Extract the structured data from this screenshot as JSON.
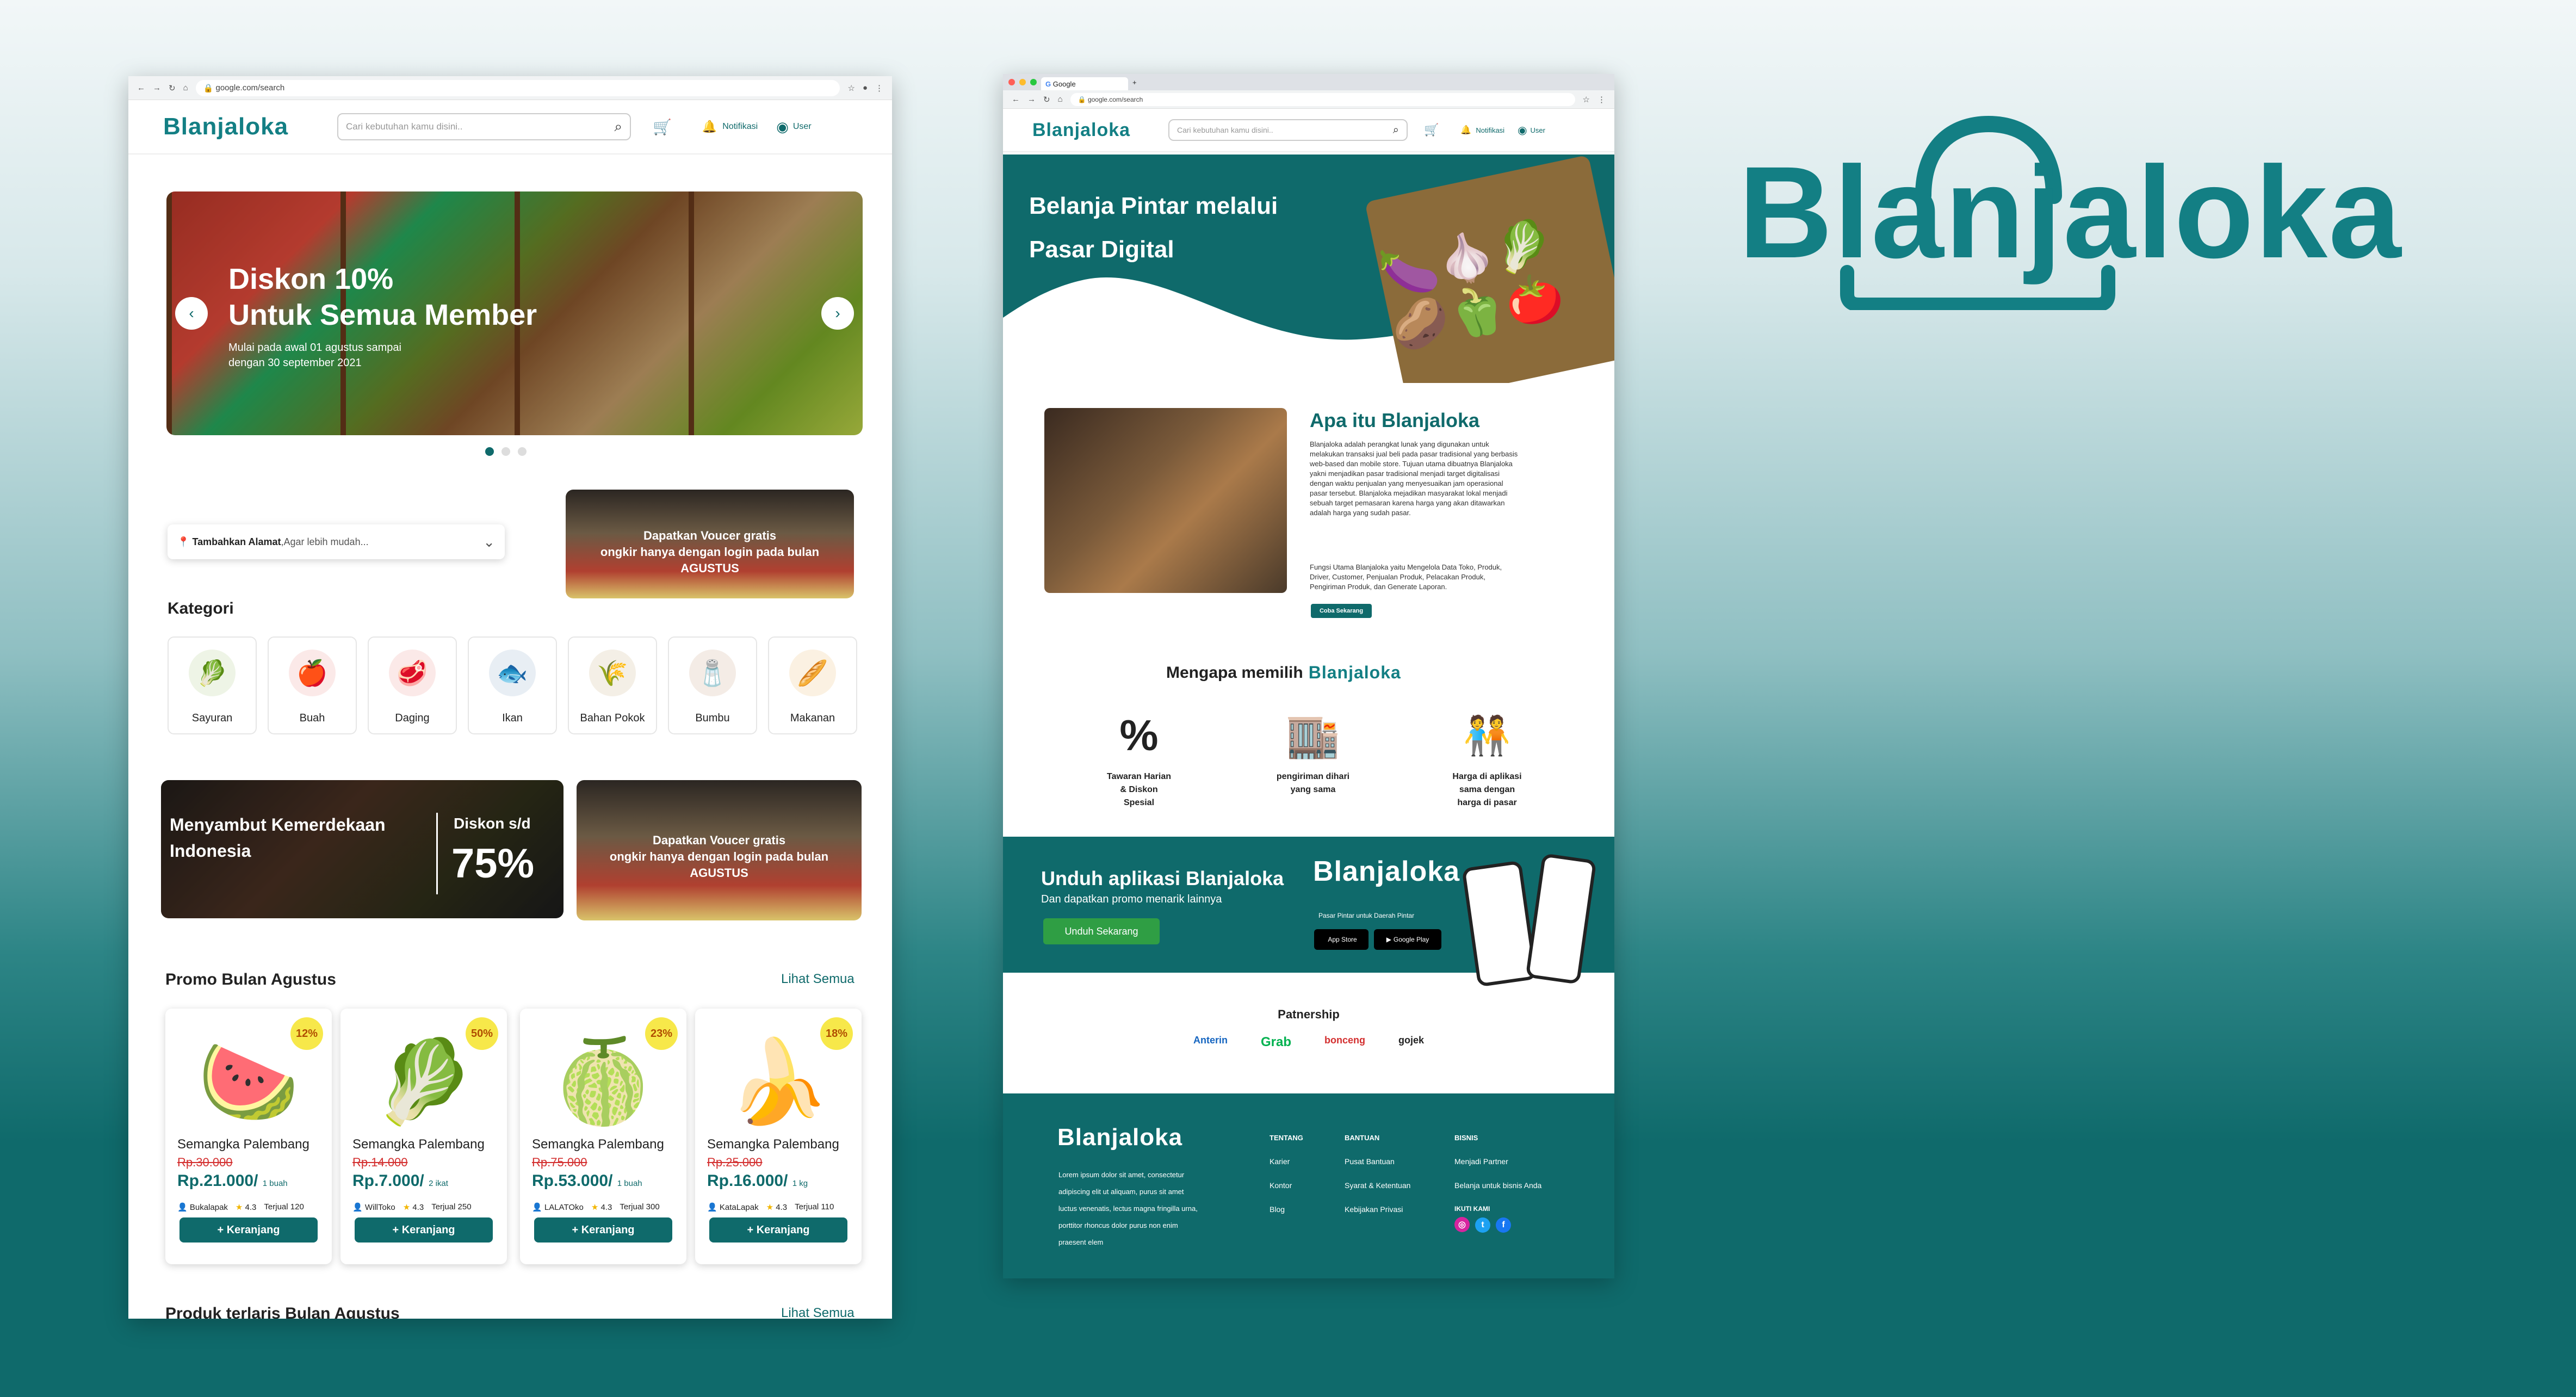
{
  "brand": {
    "name": "Blanjaloka"
  },
  "colors": {
    "primary": "#0f6a6b",
    "brand": "#137f84",
    "discount": "#d32f2f",
    "badge": "#f7e84a"
  },
  "left": {
    "url": "google.com/search",
    "search_placeholder": "Cari kebutuhan kamu disini..",
    "notif_label": "Notifikasi",
    "user_label": "User",
    "hero": {
      "title1": "Diskon 10%",
      "title2": "Untuk Semua Member",
      "sub1": "Mulai pada awal 01 agustus sampai",
      "sub2": "dengan 30 september 2021"
    },
    "address": {
      "bold": "Tambahkan Alamat",
      "rest": ",Agar lebih mudah..."
    },
    "voucher": {
      "l1": "Dapatkan Voucer gratis",
      "l2": "ongkir hanya dengan login pada bulan",
      "l3": "AGUSTUS"
    },
    "kategori_title": "Kategori",
    "categories": [
      {
        "label": "Sayuran",
        "icon": "lettuce-icon"
      },
      {
        "label": "Buah",
        "icon": "apple-icon"
      },
      {
        "label": "Daging",
        "icon": "meat-icon"
      },
      {
        "label": "Ikan",
        "icon": "fish-icon"
      },
      {
        "label": "Bahan Pokok",
        "icon": "rice-sack-icon"
      },
      {
        "label": "Bumbu",
        "icon": "pepper-mill-icon"
      },
      {
        "label": "Makanan",
        "icon": "bread-icon"
      }
    ],
    "banner_merdeka": {
      "l1": "Menyambut Kemerdekaan",
      "l2": "Indonesia",
      "diskon": "Diskon s/d",
      "pct": "75%"
    },
    "promo_title": "Promo Bulan Agustus",
    "lihat_semua": "Lihat Semua",
    "products": [
      {
        "badge": "12%",
        "name": "Semangka Palembang",
        "old": "Rp.30.000",
        "price": "Rp.21.000/",
        "unit": "1 buah",
        "store": "Bukalapak",
        "rating": "4.3",
        "sold": "Terjual 120",
        "icon": "watermelon-icon"
      },
      {
        "badge": "50%",
        "name": "Semangka Palembang",
        "old": "Rp.14.000",
        "price": "Rp.7.000/",
        "unit": "2 ikat",
        "store": "WillToko",
        "rating": "4.3",
        "sold": "Terjual 250",
        "icon": "greens-icon"
      },
      {
        "badge": "23%",
        "name": "Semangka Palembang",
        "old": "Rp.75.000",
        "price": "Rp.53.000/",
        "unit": "1 buah",
        "store": "LALATOko",
        "rating": "4.3",
        "sold": "Terjual 300",
        "icon": "durian-icon"
      },
      {
        "badge": "18%",
        "name": "Semangka Palembang",
        "old": "Rp.25.000",
        "price": "Rp.16.000/",
        "unit": "1 kg",
        "store": "KataLapak",
        "rating": "4.3",
        "sold": "Terjual 110",
        "icon": "banana-icon"
      }
    ],
    "cart_label": "+ Keranjang",
    "terlaris_title": "Produk terlaris Bulan Agustus"
  },
  "right": {
    "tab_title": "Google",
    "url": "google.com/search",
    "search_placeholder": "Cari kebutuhan kamu disini..",
    "notif_label": "Notifikasi",
    "user_label": "User",
    "hero": {
      "l1": "Belanja Pintar melalui",
      "l2": "Pasar Digital"
    },
    "about": {
      "title": "Apa itu Blanjaloka",
      "p1": "Blanjaloka adalah perangkat lunak yang digunakan untuk melakukan transaksi jual beli pada pasar tradisional yang berbasis web-based dan mobile store. Tujuan utama dibuatnya Blanjaloka yakni menjadikan pasar tradisional menjadi target digitalisasi dengan waktu penjualan yang menyesuaikan jam operasional pasar tersebut. Blanjaloka mejadikan masyarakat lokal menjadi sebuah target pemasaran karena harga yang akan ditawarkan adalah harga yang sudah pasar.",
      "p2": "Fungsi Utama Blanjaloka yaitu Mengelola Data Toko, Produk, Driver, Customer, Penjualan Produk, Pelacakan Produk, Pengiriman Produk, dan Generate Laporan.",
      "btn": "Coba Sekarang"
    },
    "why_title": "Mengapa memilih",
    "features": [
      {
        "l1": "Tawaran Harian",
        "l2": "& Diskon",
        "l3": "Spesial"
      },
      {
        "l1": "pengiriman dihari",
        "l2": "yang sama",
        "l3": ""
      },
      {
        "l1": "Harga di aplikasi",
        "l2": "sama dengan",
        "l3": "harga di pasar"
      }
    ],
    "app": {
      "title": "Unduh aplikasi Blanjaloka",
      "sub": "Dan dapatkan promo menarik lainnya",
      "btn": "Unduh Sekarang",
      "tagline": "Pasar Pintar untuk Daerah Pintar",
      "appstore": "App Store",
      "playstore": "Google Play"
    },
    "partner": {
      "title": "Patnership",
      "items": [
        "Anterin",
        "Grab",
        "bonceng",
        "gojek"
      ]
    },
    "footer": {
      "about": [
        "Lorem ipsum dolor sit amet, consectetur",
        "adipiscing elit ut aliquam, purus sit amet",
        "luctus venenatis, lectus magna fringilla urna,",
        "porttitor rhoncus dolor purus non enim",
        "praesent elem"
      ],
      "tentang": {
        "title": "TENTANG",
        "items": [
          "Karier",
          "Kontor",
          "Blog"
        ]
      },
      "bantuan": {
        "title": "BANTUAN",
        "items": [
          "Pusat Bantuan",
          "Syarat & Ketentuan",
          "Kebijakan Privasi"
        ]
      },
      "bisnis": {
        "title": "BISNIS",
        "items": [
          "Menjadi Partner",
          "Belanja untuk bisnis Anda"
        ]
      },
      "follow": "IKUTI KAMI"
    }
  }
}
